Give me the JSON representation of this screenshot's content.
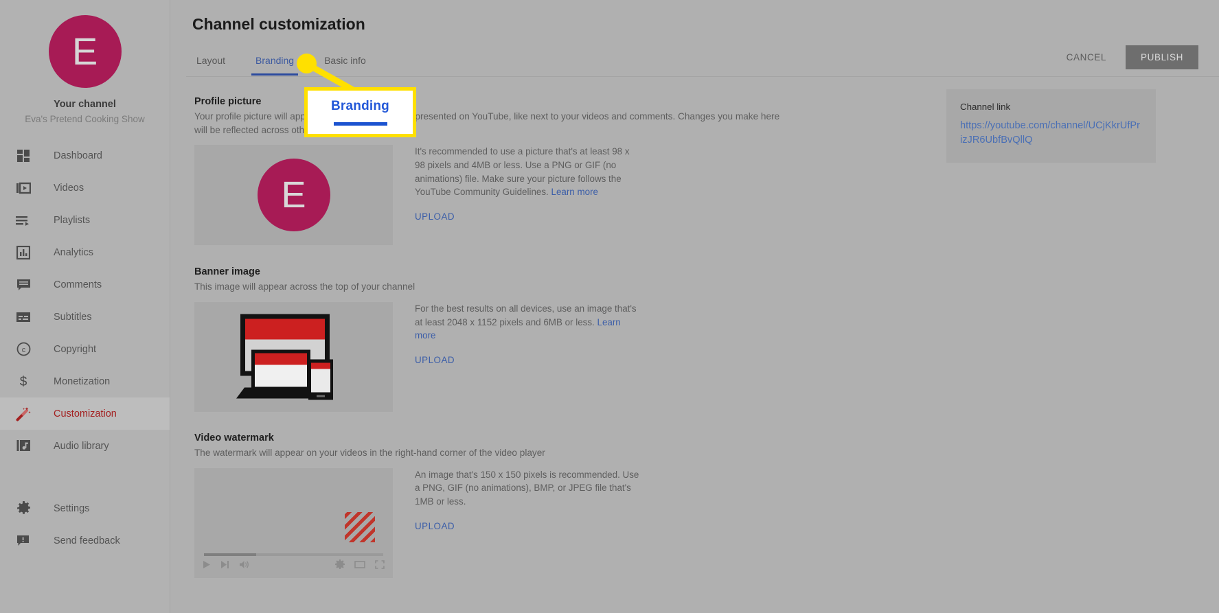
{
  "sidebar": {
    "avatar_letter": "E",
    "your_channel_label": "Your channel",
    "channel_name": "Eva's Pretend Cooking Show",
    "items": [
      {
        "label": "Dashboard",
        "icon": "dashboard-icon"
      },
      {
        "label": "Videos",
        "icon": "video-icon"
      },
      {
        "label": "Playlists",
        "icon": "playlist-icon"
      },
      {
        "label": "Analytics",
        "icon": "analytics-icon"
      },
      {
        "label": "Comments",
        "icon": "comment-icon"
      },
      {
        "label": "Subtitles",
        "icon": "subtitles-icon"
      },
      {
        "label": "Copyright",
        "icon": "copyright-icon"
      },
      {
        "label": "Monetization",
        "icon": "dollar-icon"
      },
      {
        "label": "Customization",
        "icon": "magic-wand-icon"
      },
      {
        "label": "Audio library",
        "icon": "audio-library-icon"
      }
    ],
    "bottom_items": [
      {
        "label": "Settings",
        "icon": "gear-icon"
      },
      {
        "label": "Send feedback",
        "icon": "feedback-icon"
      }
    ],
    "active_item": "Customization"
  },
  "header": {
    "title": "Channel customization",
    "cancel_label": "CANCEL",
    "publish_label": "PUBLISH"
  },
  "tabs": [
    {
      "label": "Layout",
      "active": false
    },
    {
      "label": "Branding",
      "active": true
    },
    {
      "label": "Basic info",
      "active": false
    }
  ],
  "sections": {
    "profile_picture": {
      "title": "Profile picture",
      "description": "Your profile picture will appear where your channel is presented on YouTube, like next to your videos and comments. Changes you make here will be reflected across other Google services.",
      "hint": "It's recommended to use a picture that's at least 98 x 98 pixels and 4MB or less. Use a PNG or GIF (no animations) file. Make sure your picture follows the YouTube Community Guidelines.",
      "learn_more": "Learn more",
      "upload_label": "UPLOAD",
      "preview_letter": "E"
    },
    "banner_image": {
      "title": "Banner image",
      "description": "This image will appear across the top of your channel",
      "hint": "For the best results on all devices, use an image that's at least 2048 x 1152 pixels and 6MB or less.",
      "learn_more": "Learn more",
      "upload_label": "UPLOAD"
    },
    "video_watermark": {
      "title": "Video watermark",
      "description": "The watermark will appear on your videos in the right-hand corner of the video player",
      "hint": "An image that's 150 x 150 pixels is recommended. Use a PNG, GIF (no animations), BMP, or JPEG file that's 1MB or less.",
      "upload_label": "UPLOAD",
      "player_controls": [
        "play-icon",
        "next-icon",
        "volume-icon",
        "gear-icon",
        "theater-icon",
        "fullscreen-icon"
      ]
    }
  },
  "channel_link_card": {
    "title": "Channel link",
    "url": "https://youtube.com/channel/UCjKkrUfPrizJR6UbfBvQllQ"
  },
  "annotation": {
    "callout_text": "Branding"
  },
  "colors": {
    "brand_magenta": "#a71b55",
    "link_blue": "#3c5ea8",
    "tab_active_blue": "#2b4a9e",
    "active_nav_red": "#a32020",
    "annotation_yellow": "#ffe000",
    "callout_blue": "#2358d8",
    "publish_bg": "#6e6e6e"
  }
}
